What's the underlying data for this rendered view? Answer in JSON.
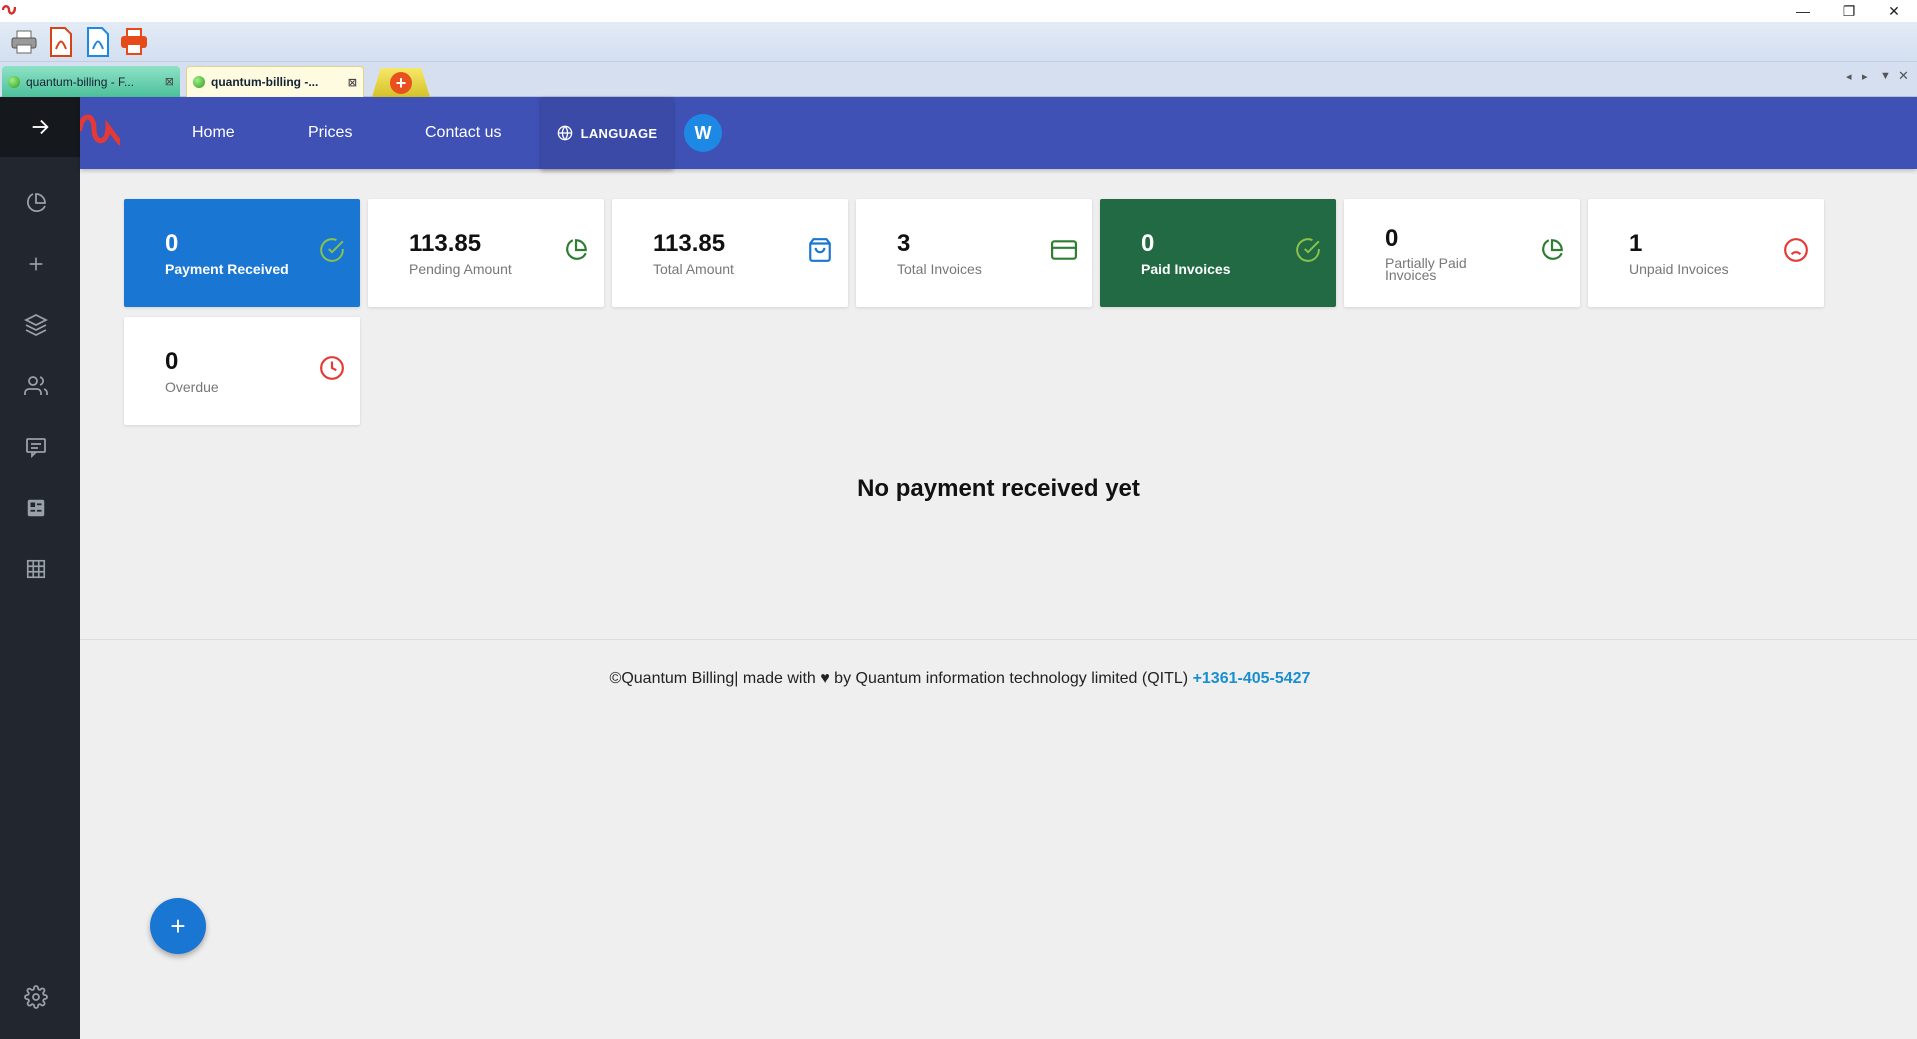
{
  "browser": {
    "tabs": [
      {
        "label": "quantum-billing - F..."
      },
      {
        "label": "quantum-billing -..."
      }
    ],
    "window_controls": {
      "minimize": "—",
      "maximize": "❐",
      "close": "✕"
    }
  },
  "nav": {
    "home": "Home",
    "prices": "Prices",
    "contact": "Contact us",
    "language": "LANGUAGE",
    "avatar_initial": "W"
  },
  "cards": [
    {
      "value": "0",
      "label": "Payment Received",
      "style": "blue",
      "icon": "check-circle-icon",
      "icon_color": "#8bc34a"
    },
    {
      "value": "113.85",
      "label": "Pending Amount",
      "style": "white",
      "icon": "pie-chart-icon",
      "icon_color": "#2e7d32"
    },
    {
      "value": "113.85",
      "label": "Total Amount",
      "style": "white",
      "icon": "shopping-bag-icon",
      "icon_color": "#1976d2"
    },
    {
      "value": "3",
      "label": "Total Invoices",
      "style": "white",
      "icon": "credit-card-icon",
      "icon_color": "#2e7d32"
    },
    {
      "value": "0",
      "label": "Paid Invoices",
      "style": "green",
      "icon": "check-circle-icon",
      "icon_color": "#8bc34a"
    },
    {
      "value": "0",
      "label": "Partially Paid Invoices",
      "style": "white",
      "icon": "pie-chart-icon",
      "icon_color": "#2e7d32"
    },
    {
      "value": "1",
      "label": "Unpaid Invoices",
      "style": "white",
      "icon": "frown-icon",
      "icon_color": "#e53935"
    },
    {
      "value": "0",
      "label": "Overdue",
      "style": "white",
      "icon": "clock-icon",
      "icon_color": "#e53935"
    }
  ],
  "main": {
    "empty_message": "No payment received yet"
  },
  "footer": {
    "text": "©Quantum Billing| made with ♥ by Quantum information technology limited (QITL)",
    "phone": "+1361-405-5427"
  },
  "fab": {
    "label": "+"
  },
  "sidebar_icons": [
    "arrow-right-icon",
    "pie-chart-icon",
    "plus-icon",
    "layers-icon",
    "users-icon",
    "message-icon",
    "invoice-icon",
    "grid-icon",
    "settings-icon"
  ]
}
